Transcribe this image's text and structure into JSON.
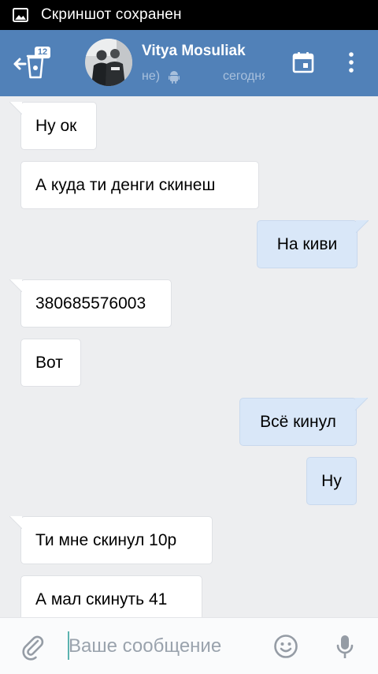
{
  "status_bar": {
    "text": "Скриншот сохранен",
    "icon": "image-icon"
  },
  "toolbar": {
    "back_badge": "12",
    "contact_name": "Vitya Mosuliak",
    "status_left": "не)",
    "status_right": "сегодня",
    "accent_color": "#5181b8"
  },
  "messages": [
    {
      "text": "Ну ок",
      "direction": "in"
    },
    {
      "text": "А куда ти денги скинеш",
      "direction": "in"
    },
    {
      "text": "На киви",
      "direction": "out"
    },
    {
      "text": "380685576003",
      "direction": "in"
    },
    {
      "text": "Вот",
      "direction": "in"
    },
    {
      "text": "Всё кинул",
      "direction": "out"
    },
    {
      "text": "Ну",
      "direction": "out"
    },
    {
      "text": "Ти мне скинул 10р",
      "direction": "in"
    },
    {
      "text": "А мал скинуть 41",
      "direction": "in"
    }
  ],
  "input_bar": {
    "placeholder": "Ваше сообщение"
  }
}
